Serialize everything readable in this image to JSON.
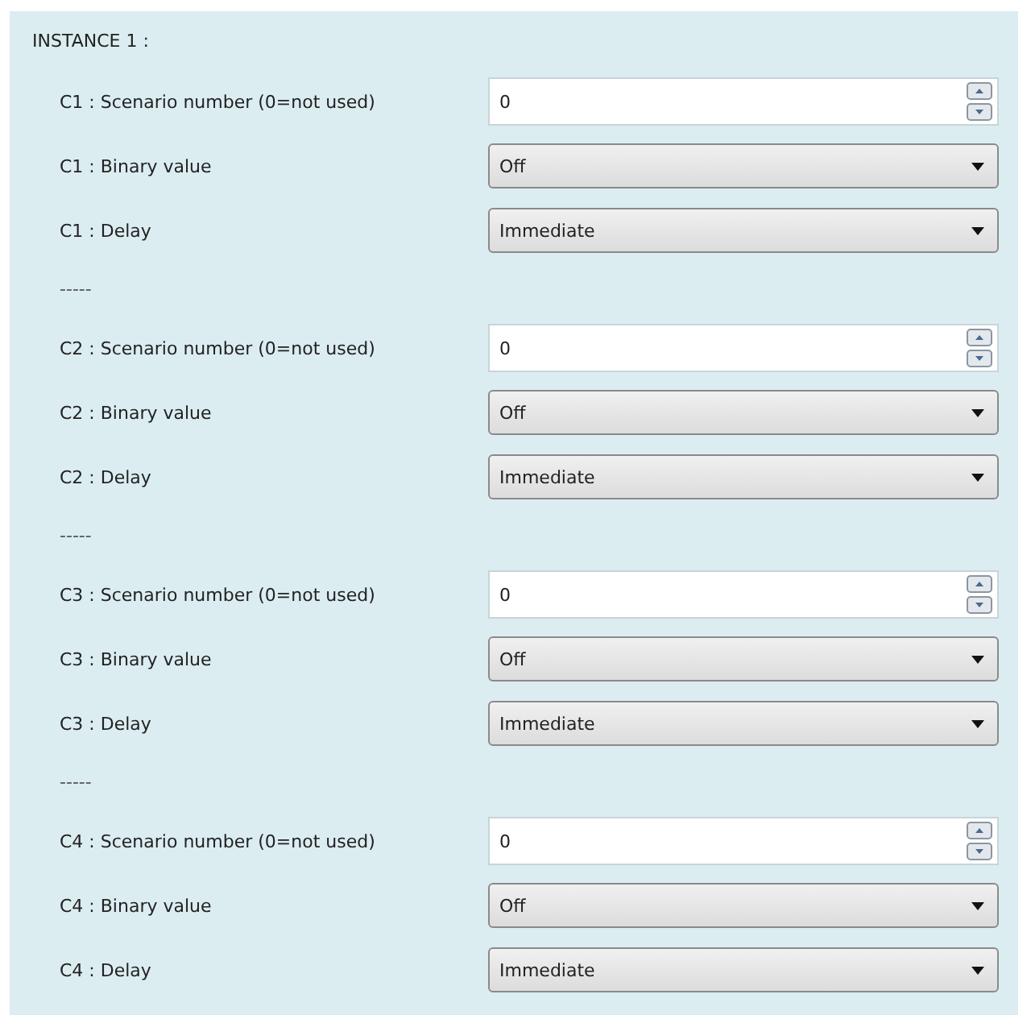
{
  "title": "INSTANCE 1 :",
  "rows": [
    {
      "kind": "spin",
      "label": "C1 : Scenario number (0=not used)",
      "value": "0"
    },
    {
      "kind": "dropdown",
      "label": "C1 : Binary value",
      "value": "Off"
    },
    {
      "kind": "dropdown",
      "label": "C1 : Delay",
      "value": "Immediate"
    },
    {
      "kind": "separator",
      "label": "-----"
    },
    {
      "kind": "spin",
      "label": "C2 : Scenario number (0=not used)",
      "value": "0"
    },
    {
      "kind": "dropdown",
      "label": "C2 : Binary value",
      "value": "Off"
    },
    {
      "kind": "dropdown",
      "label": "C2 : Delay",
      "value": "Immediate"
    },
    {
      "kind": "separator",
      "label": "-----"
    },
    {
      "kind": "spin",
      "label": "C3 : Scenario number (0=not used)",
      "value": "0"
    },
    {
      "kind": "dropdown",
      "label": "C3 : Binary value",
      "value": "Off"
    },
    {
      "kind": "dropdown",
      "label": "C3 : Delay",
      "value": "Immediate"
    },
    {
      "kind": "separator",
      "label": "-----"
    },
    {
      "kind": "spin",
      "label": "C4 : Scenario number (0=not used)",
      "value": "0"
    },
    {
      "kind": "dropdown",
      "label": "C4 : Binary value",
      "value": "Off"
    },
    {
      "kind": "dropdown",
      "label": "C4 : Delay",
      "value": "Immediate"
    }
  ]
}
